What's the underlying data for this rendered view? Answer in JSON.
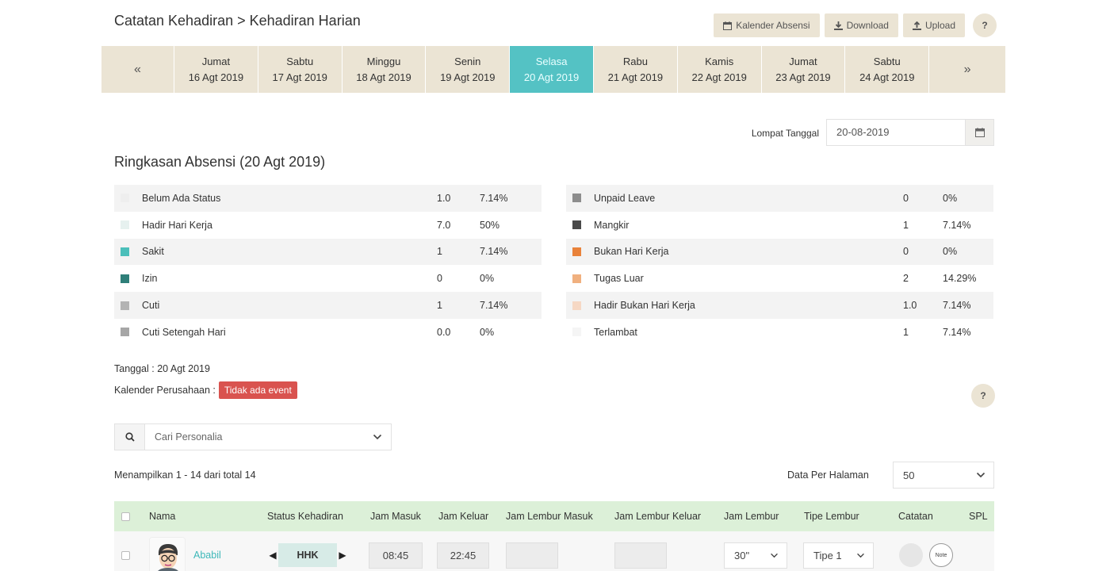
{
  "header": {
    "title": "Catatan Kehadiran > Kehadiran Harian",
    "actions": {
      "calendar": "Kalender Absensi",
      "download": "Download",
      "upload": "Upload",
      "help": "?"
    }
  },
  "date_strip": {
    "prev": "«",
    "next": "»",
    "days": [
      {
        "day": "Jumat",
        "date": "16 Agt 2019"
      },
      {
        "day": "Sabtu",
        "date": "17 Agt 2019"
      },
      {
        "day": "Minggu",
        "date": "18 Agt 2019"
      },
      {
        "day": "Senin",
        "date": "19 Agt 2019"
      },
      {
        "day": "Selasa",
        "date": "20 Agt 2019"
      },
      {
        "day": "Rabu",
        "date": "21 Agt 2019"
      },
      {
        "day": "Kamis",
        "date": "22 Agt 2019"
      },
      {
        "day": "Jumat",
        "date": "23 Agt 2019"
      },
      {
        "day": "Sabtu",
        "date": "24 Agt 2019"
      }
    ],
    "active_index": 4
  },
  "jump": {
    "label": "Lompat Tanggal",
    "value": "20-08-2019"
  },
  "summary": {
    "title": "Ringkasan Absensi (20 Agt 2019)",
    "left": [
      {
        "label": "Belum Ada Status",
        "count": "1.0",
        "pct": "7.14%",
        "color": "#eeeeee"
      },
      {
        "label": "Hadir Hari Kerja",
        "count": "7.0",
        "pct": "50%",
        "color": "#e6f1ef"
      },
      {
        "label": "Sakit",
        "count": "1",
        "pct": "7.14%",
        "color": "#4bbfba"
      },
      {
        "label": "Izin",
        "count": "0",
        "pct": "0%",
        "color": "#2f7f79"
      },
      {
        "label": "Cuti",
        "count": "1",
        "pct": "7.14%",
        "color": "#b3b3b3"
      },
      {
        "label": "Cuti Setengah Hari",
        "count": "0.0",
        "pct": "0%",
        "color": "#a6a6a6"
      }
    ],
    "right": [
      {
        "label": "Unpaid Leave",
        "count": "0",
        "pct": "0%",
        "color": "#8d8d8d"
      },
      {
        "label": "Mangkir",
        "count": "1",
        "pct": "7.14%",
        "color": "#4a4a4a"
      },
      {
        "label": "Bukan Hari Kerja",
        "count": "0",
        "pct": "0%",
        "color": "#e9823a"
      },
      {
        "label": "Tugas Luar",
        "count": "2",
        "pct": "14.29%",
        "color": "#f0b07f"
      },
      {
        "label": "Hadir Bukan Hari Kerja",
        "count": "1.0",
        "pct": "7.14%",
        "color": "#f6d8c4"
      },
      {
        "label": "Terlambat",
        "count": "1",
        "pct": "7.14%",
        "color": "#f5f5f5"
      }
    ]
  },
  "info": {
    "date": "Tanggal : 20 Agt 2019",
    "calendar_label": "Kalender Perusahaan :",
    "calendar_badge": "Tidak ada event",
    "help": "?"
  },
  "search": {
    "placeholder": "Cari Personalia"
  },
  "list": {
    "showing": "Menampilkan 1 - 14 dari total 14",
    "per_page_label": "Data Per Halaman",
    "per_page_value": "50"
  },
  "table": {
    "columns": {
      "name": "Nama",
      "status": "Status Kehadiran",
      "in": "Jam Masuk",
      "out": "Jam Keluar",
      "ot_in": "Jam Lembur Masuk",
      "ot_out": "Jam Lembur Keluar",
      "ot_hours": "Jam Lembur",
      "ot_type": "Tipe Lembur",
      "notes": "Catatan",
      "spl": "SPL"
    },
    "rows": [
      {
        "name": "Ababil",
        "status": "HHK",
        "in": "08:45",
        "out": "22:45",
        "ot_in": "",
        "ot_out": "",
        "ot_hours": "30\"",
        "ot_type": "Tipe 1",
        "note_label": "Note"
      }
    ]
  }
}
